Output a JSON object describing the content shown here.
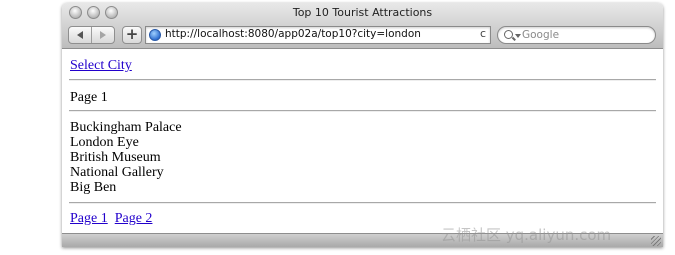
{
  "window": {
    "title": "Top 10 Tourist Attractions"
  },
  "toolbar": {
    "back_icon": "back-arrow-icon",
    "forward_icon": "forward-arrow-icon",
    "add_bookmark_label": "+",
    "url": "http://localhost:8080/app02a/top10?city=london",
    "reload_symbol": "c",
    "search_placeholder": "Google"
  },
  "page": {
    "select_city_link": "Select City",
    "page_label": "Page 1",
    "attractions": [
      "Buckingham Palace",
      "London Eye",
      "British Museum",
      "National Gallery",
      "Big Ben"
    ],
    "pager": [
      "Page 1",
      "Page 2"
    ]
  },
  "watermark": "云栖社区 yq.aliyun.com",
  "colors": {
    "link": "#2200cc",
    "divider": "#a8a8a8"
  }
}
